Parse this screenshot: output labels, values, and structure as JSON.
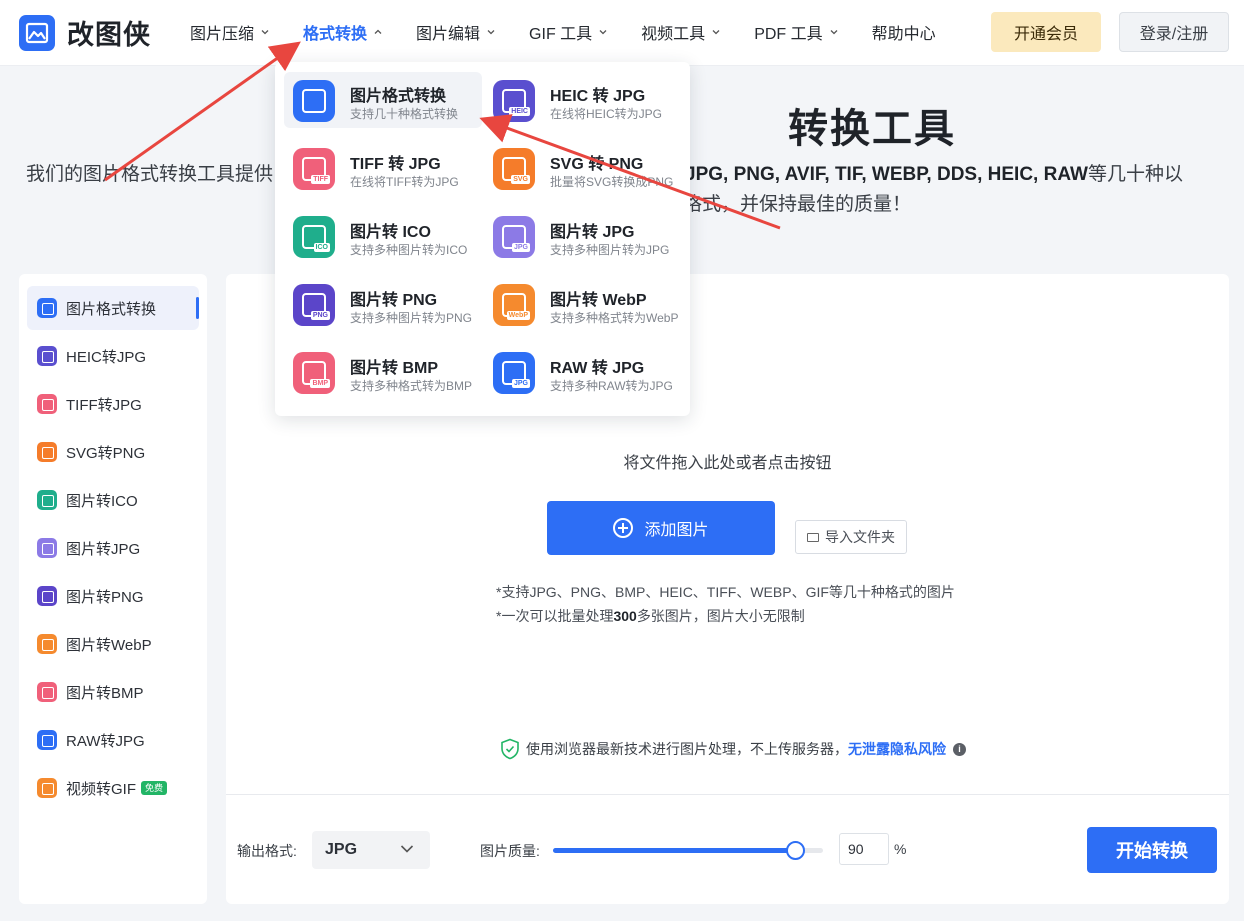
{
  "header": {
    "logo_text": "改图侠",
    "nav": [
      {
        "label": "图片压缩",
        "active": false
      },
      {
        "label": "格式转换",
        "active": true
      },
      {
        "label": "图片编辑",
        "active": false
      },
      {
        "label": "GIF 工具",
        "active": false
      },
      {
        "label": "视频工具",
        "active": false
      },
      {
        "label": "PDF 工具",
        "active": false
      },
      {
        "label": "帮助中心",
        "active": false
      }
    ],
    "vip_label": "开通会员",
    "login_label": "登录/注册"
  },
  "hero": {
    "title": "转换工具",
    "subtitle_line1_left": "我们的图片格式转换工具提供",
    "subtitle_line1_right": "JPG, PNG, AVIF, TIF, WEBP, DDS, HEIC, RAW",
    "subtitle_line1_tail": "等几十种以",
    "subtitle_line2": "格式，并保持最佳的质量！"
  },
  "dropdown": {
    "items": [
      {
        "title": "图片格式转换",
        "desc": "支持几十种格式转换",
        "color": "#2d6ef5",
        "tag": "",
        "icon": "convert-icon",
        "active": true
      },
      {
        "title": "HEIC 转 JPG",
        "desc": "在线将HEIC转为JPG",
        "color": "#5a4fcf",
        "tag": "HEIC",
        "icon": "heic-icon",
        "active": false
      },
      {
        "title": "TIFF 转 JPG",
        "desc": "在线将TIFF转为JPG",
        "color": "#f0607a",
        "tag": "TIFF",
        "icon": "tiff-icon",
        "active": false
      },
      {
        "title": "SVG 转 PNG",
        "desc": "批量将SVG转换成PNG",
        "color": "#f57c2a",
        "tag": "SVG",
        "icon": "svg-icon",
        "active": false
      },
      {
        "title": "图片转 ICO",
        "desc": "支持多种图片转为ICO",
        "color": "#1fae8c",
        "tag": "ICO",
        "icon": "ico-icon",
        "active": false
      },
      {
        "title": "图片转 JPG",
        "desc": "支持多种图片转为JPG",
        "color": "#8c7ae6",
        "tag": "JPG",
        "icon": "jpg-icon",
        "active": false
      },
      {
        "title": "图片转 PNG",
        "desc": "支持多种图片转为PNG",
        "color": "#5b45c9",
        "tag": "PNG",
        "icon": "png-icon",
        "active": false
      },
      {
        "title": "图片转 WebP",
        "desc": "支持多种格式转为WebP",
        "color": "#f58a2e",
        "tag": "WebP",
        "icon": "webp-icon",
        "active": false
      },
      {
        "title": "图片转 BMP",
        "desc": "支持多种格式转为BMP",
        "color": "#f0607a",
        "tag": "BMP",
        "icon": "bmp-icon",
        "active": false
      },
      {
        "title": "RAW 转 JPG",
        "desc": "支持多种RAW转为JPG",
        "color": "#2d6ef5",
        "tag": "JPG",
        "icon": "raw-icon",
        "active": false
      }
    ]
  },
  "sidebar": {
    "items": [
      {
        "label": "图片格式转换",
        "color": "#2d6ef5",
        "active": true
      },
      {
        "label": "HEIC转JPG",
        "color": "#5a4fcf",
        "active": false
      },
      {
        "label": "TIFF转JPG",
        "color": "#f0607a",
        "active": false
      },
      {
        "label": "SVG转PNG",
        "color": "#f57c2a",
        "active": false
      },
      {
        "label": "图片转ICO",
        "color": "#1fae8c",
        "active": false
      },
      {
        "label": "图片转JPG",
        "color": "#8c7ae6",
        "active": false
      },
      {
        "label": "图片转PNG",
        "color": "#5b45c9",
        "active": false
      },
      {
        "label": "图片转WebP",
        "color": "#f58a2e",
        "active": false
      },
      {
        "label": "图片转BMP",
        "color": "#f0607a",
        "active": false
      },
      {
        "label": "RAW转JPG",
        "color": "#2d6ef5",
        "active": false
      },
      {
        "label": "视频转GIF",
        "color": "#f58a2e",
        "active": false,
        "badge": "免费"
      }
    ]
  },
  "upload": {
    "drop_text": "将文件拖入此处或者点击按钮",
    "add_label": "添加图片",
    "folder_label": "导入文件夹",
    "note1": "*支持JPG、PNG、BMP、HEIC、TIFF、WEBP、GIF等几十种格式的图片",
    "note2_prefix": "*一次可以批量处理",
    "note2_count": "300",
    "note2_suffix": "多张图片，图片大小无限制",
    "privacy_text": "使用浏览器最新技术进行图片处理，不上传服务器，",
    "privacy_link": "无泄露隐私风险"
  },
  "settings": {
    "output_label": "输出格式:",
    "format_value": "JPG",
    "quality_label": "图片质量:",
    "quality_value": "90",
    "quality_fraction": 0.9,
    "quality_unit": "%",
    "start_label": "开始转换"
  }
}
